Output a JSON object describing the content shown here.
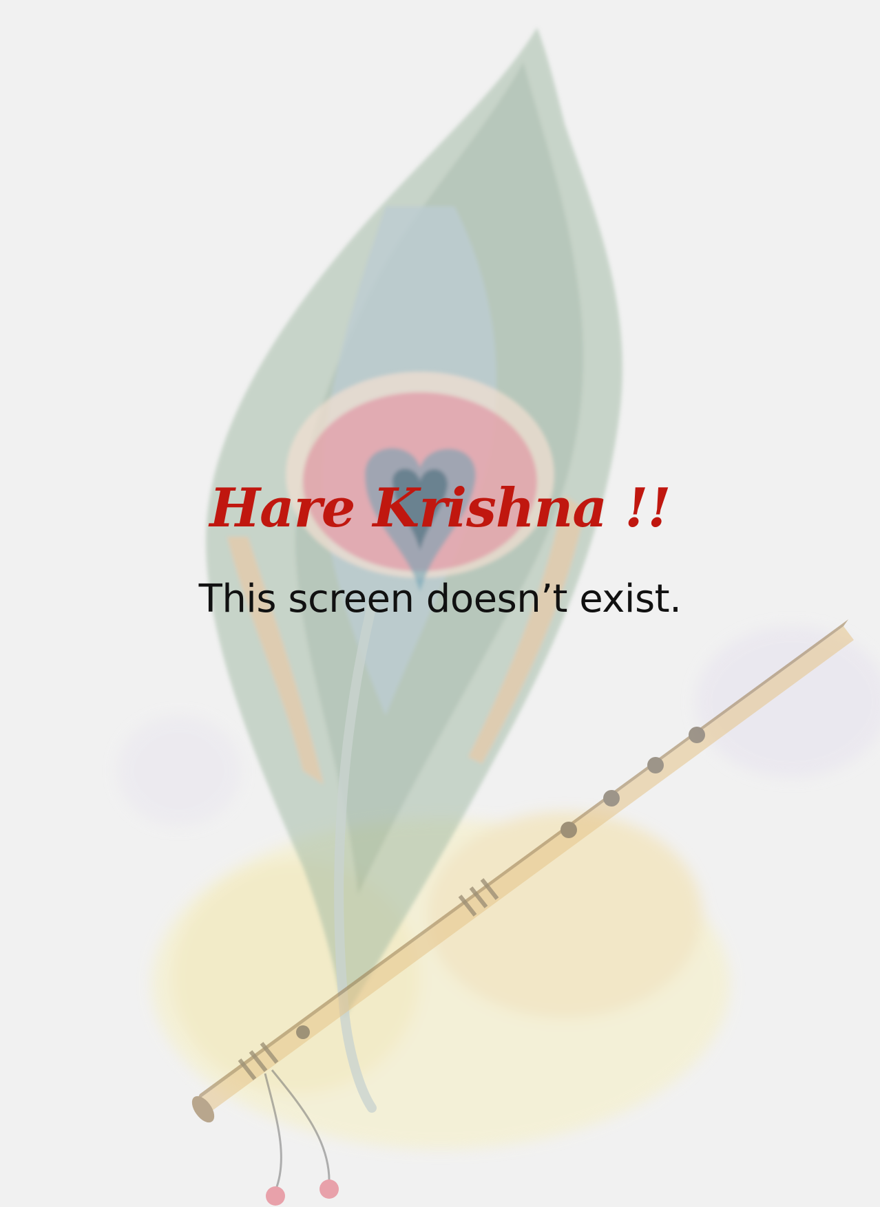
{
  "screen": {
    "title": "Hare Krishna !!",
    "message": "This screen doesn’t exist."
  },
  "background": {
    "illustration": "peacock-feather-and-flute-watercolor"
  },
  "colors": {
    "background": "#f1f1f1",
    "title": "#c0170f",
    "message": "#111111"
  }
}
